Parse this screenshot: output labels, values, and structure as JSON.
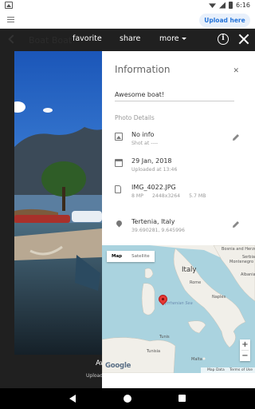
{
  "status_bar": {
    "time": "6:16"
  },
  "browser": {
    "upload_button": "Upload here"
  },
  "viewer": {
    "title": "Boat Boat",
    "toolbar": {
      "favorite": "favorite",
      "share": "share",
      "more": "more"
    },
    "caption": "Awesome boat!",
    "subcaption": "Uploaded"
  },
  "info_panel": {
    "title": "Information",
    "description_value": "Awesome boat!",
    "details_header": "Photo Details",
    "camera": {
      "main": "No info",
      "sub": "Shot at ----"
    },
    "date": {
      "main": "29 Jan, 2018",
      "sub": "Uploaded at 13:46"
    },
    "file": {
      "name": "IMG_4022.JPG",
      "megapixels": "8 MP",
      "dimensions": "2448x3264",
      "size": "5.7 MB"
    },
    "location": {
      "main": "Tertenia, Italy",
      "sub": "39.690281, 9.645996"
    }
  },
  "map": {
    "type_buttons": {
      "map": "Map",
      "satellite": "Satellite"
    },
    "zoom_in": "+",
    "zoom_out": "−",
    "logo": "Google",
    "attribution": {
      "data": "Map Data",
      "terms": "Terms of Use"
    },
    "labels": {
      "italy": "Italy",
      "rome": "Rome",
      "naples": "Naples",
      "bosnia": "Bosnia and Herzegovina",
      "serbia": "Serbia",
      "montenegro": "Montenegro",
      "albania": "Albania",
      "sea": "Tyrrhenian Sea",
      "tunis": "Tunis",
      "malta": "Malta",
      "tunisia": "Tunisia"
    }
  },
  "colors": {
    "accent": "#2574d9",
    "pin": "#e53935",
    "water": "#aad3df",
    "land": "#f1efe9"
  }
}
